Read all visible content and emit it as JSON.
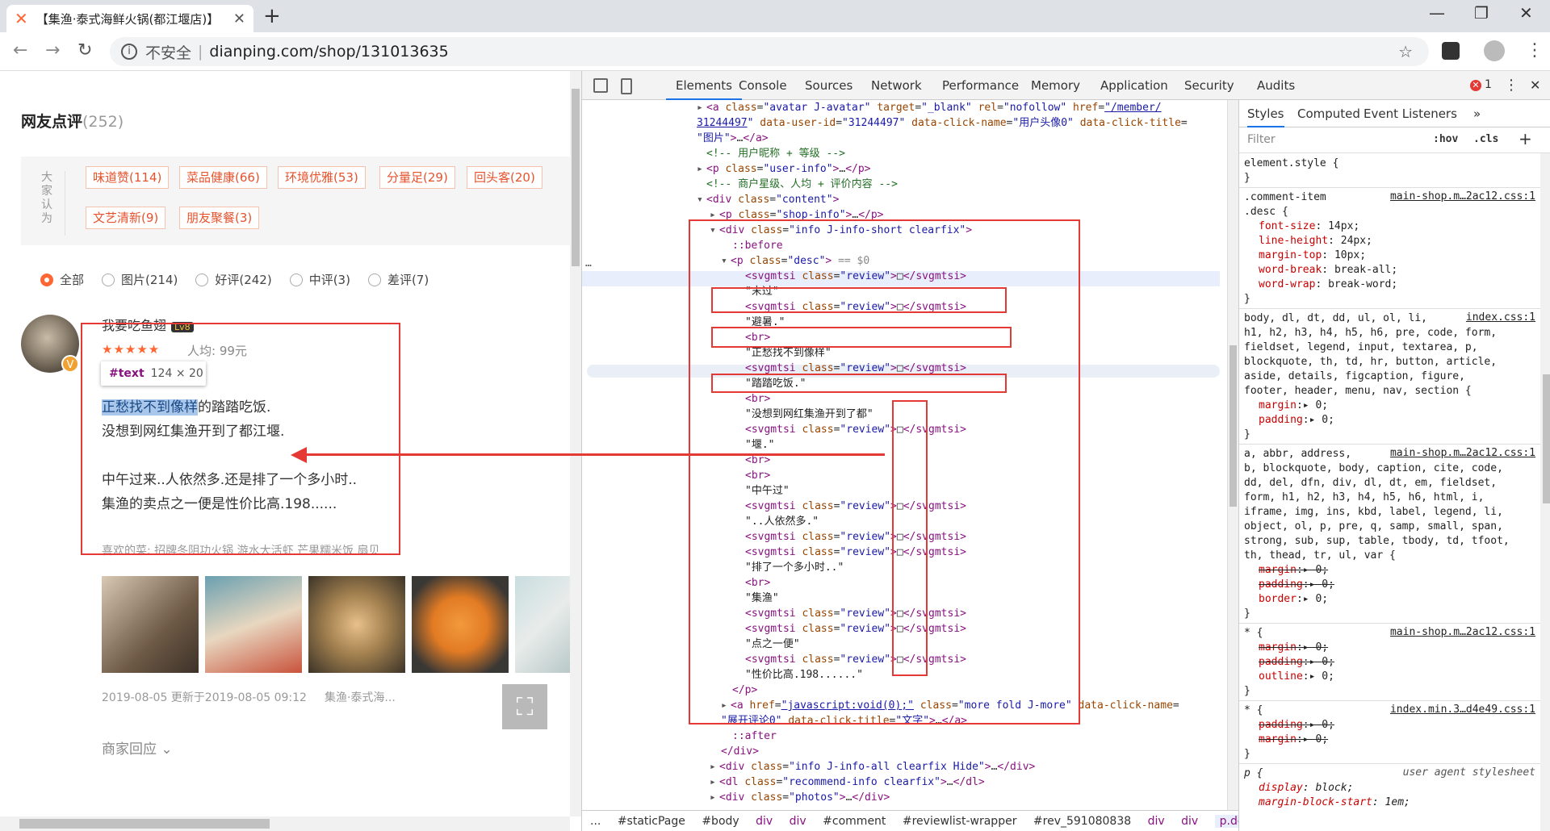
{
  "browser": {
    "tab_title": "【集渔·泰式海鲜火锅(都江堰店)】",
    "insecure": "不安全",
    "separator": "|",
    "url": "dianping.com/shop/131013635"
  },
  "page": {
    "section_title": "网友点评",
    "section_count": "(252)",
    "tag_group_label": "大家认为",
    "tags": [
      "味道赞(114)",
      "菜品健康(66)",
      "环境优雅(53)",
      "分量足(29)",
      "回头客(20)",
      "文艺清新(9)",
      "朋友聚餐(3)"
    ],
    "filters": [
      "全部",
      "图片(214)",
      "好评(242)",
      "中评(3)",
      "差评(7)"
    ],
    "review": {
      "username": "我要吃鱼翅",
      "level": "Lv8",
      "stars": "★★★★★",
      "avg_cost": "人均:  99元",
      "tooltip_node": "#text",
      "tooltip_size": "124 × 20",
      "line1_hl": "正愁找不到像样",
      "line1_rest": "的踏踏吃饭.",
      "line2": "没想到网红集渔开到了都江堰.",
      "line3": "中午过来..人依然多.还是排了一个多小时..",
      "line4": "集渔的卖点之一便是性价比高.198......",
      "liked": "喜欢的菜:  招牌冬阴功火锅  游水大活虾  芒果糯米饭  扇贝",
      "date": "2019-08-05   更新于2019-08-05 09:12",
      "shop": "集渔·泰式海...",
      "reply": "商家回应"
    }
  },
  "devtools": {
    "tabs": [
      "Elements",
      "Console",
      "Sources",
      "Network",
      "Performance",
      "Memory",
      "Application",
      "Security",
      "Audits"
    ],
    "error_count": "1",
    "breadcrumbs": [
      "...",
      "#staticPage",
      "#body",
      "div",
      "div",
      "#comment",
      "#reviewlist-wrapper",
      "#rev_591080838",
      "div",
      "div",
      "p.desc"
    ],
    "sidebar_tabs": [
      "Styles",
      "Computed",
      "Event Listeners"
    ],
    "filter_placeholder": "Filter",
    "hov": ":hov",
    "cls": ".cls"
  }
}
